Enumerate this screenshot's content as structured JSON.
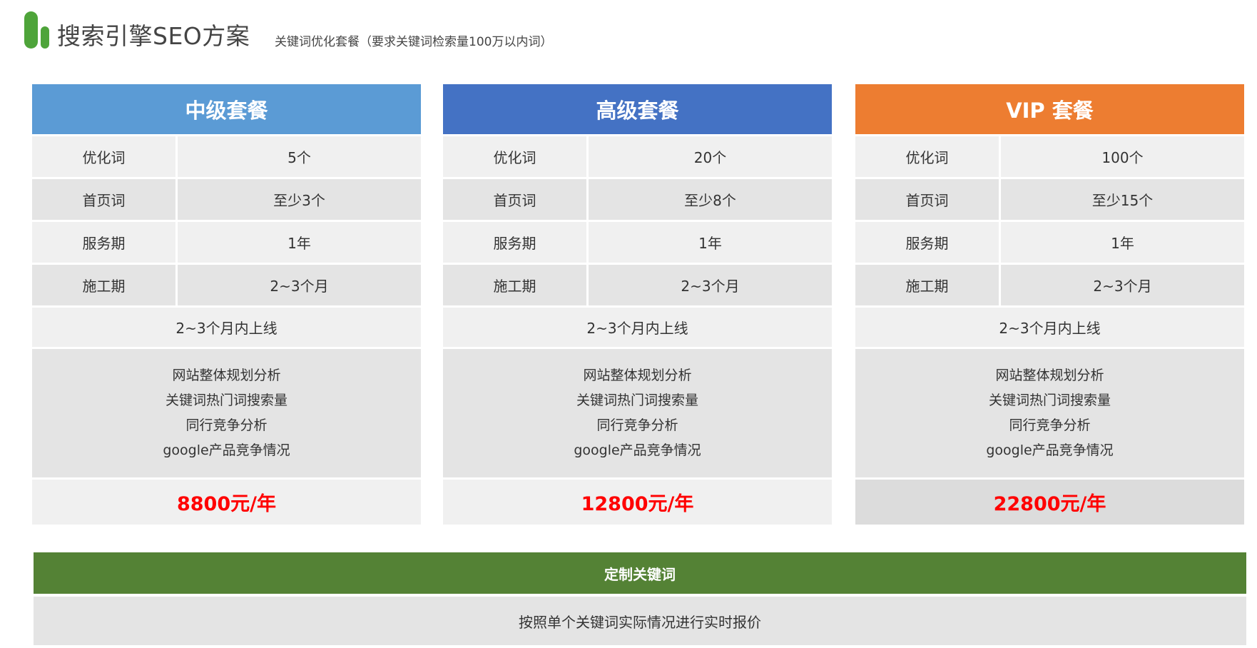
{
  "header": {
    "title": "搜索引擎SEO方案",
    "subtitle": "关键词优化套餐（要求关键词检索量100万以内词）"
  },
  "colors": {
    "logo": "#4ea43a",
    "plan_mid": "#5b9bd5",
    "plan_high": "#4472c4",
    "plan_vip": "#ed7d31",
    "price": "#ff0000",
    "custom_header": "#548235"
  },
  "plans": [
    {
      "name": "中级套餐",
      "rows": [
        {
          "label": "优化词",
          "value": "5个"
        },
        {
          "label": "首页词",
          "value": "至少3个"
        },
        {
          "label": "服务期",
          "value": "1年"
        },
        {
          "label": "施工期",
          "value": "2~3个月"
        }
      ],
      "online": "2~3个月内上线",
      "features": [
        "网站整体规划分析",
        "关键词热门词搜索量",
        "同行竞争分析",
        "google产品竞争情况"
      ],
      "price": "8800元/年"
    },
    {
      "name": "高级套餐",
      "rows": [
        {
          "label": "优化词",
          "value": "20个"
        },
        {
          "label": "首页词",
          "value": "至少8个"
        },
        {
          "label": "服务期",
          "value": "1年"
        },
        {
          "label": "施工期",
          "value": "2~3个月"
        }
      ],
      "online": "2~3个月内上线",
      "features": [
        "网站整体规划分析",
        "关键词热门词搜索量",
        "同行竞争分析",
        "google产品竞争情况"
      ],
      "price": "12800元/年"
    },
    {
      "name": "VIP 套餐",
      "rows": [
        {
          "label": "优化词",
          "value": "100个"
        },
        {
          "label": "首页词",
          "value": "至少15个"
        },
        {
          "label": "服务期",
          "value": "1年"
        },
        {
          "label": "施工期",
          "value": "2~3个月"
        }
      ],
      "online": "2~3个月内上线",
      "features": [
        "网站整体规划分析",
        "关键词热门词搜索量",
        "同行竞争分析",
        "google产品竞争情况"
      ],
      "price": "22800元/年"
    }
  ],
  "custom": {
    "title": "定制关键词",
    "description": "按照单个关键词实际情况进行实时报价"
  }
}
